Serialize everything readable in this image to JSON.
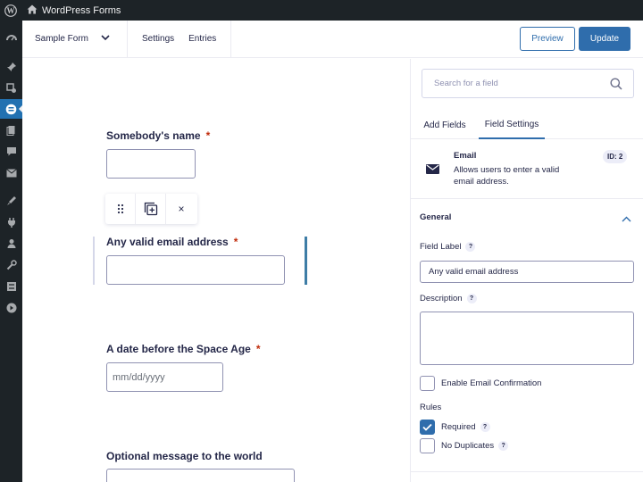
{
  "admin_bar": {
    "site_title": "WordPress Forms"
  },
  "header": {
    "form_name": "Sample Form",
    "nav": [
      "Settings",
      "Entries"
    ],
    "preview_label": "Preview",
    "update_label": "Update"
  },
  "canvas": {
    "fields": [
      {
        "label": "Somebody's name",
        "required_mark": "*"
      },
      {
        "label": "Any valid email address",
        "required_mark": "*"
      },
      {
        "label": "A date before the Space Age",
        "required_mark": "*",
        "placeholder": "mm/dd/yyyy"
      },
      {
        "label": "Optional message to the world"
      }
    ],
    "toolbar": {
      "close_glyph": "×"
    }
  },
  "sidebar": {
    "search_placeholder": "Search for a field",
    "tabs": [
      "Add Fields",
      "Field Settings"
    ],
    "active_tab": "Field Settings",
    "field": {
      "title": "Email",
      "description": "Allows users to enter a valid email address.",
      "id_badge": "ID: 2"
    },
    "general": {
      "heading": "General",
      "field_label_title": "Field Label",
      "field_label_value": "Any valid email address",
      "description_title": "Description",
      "description_value": "",
      "enable_confirmation": "Enable Email Confirmation",
      "rules_title": "Rules",
      "required": "Required",
      "required_checked": true,
      "no_duplicates": "No Duplicates",
      "no_duplicates_checked": false,
      "help_glyph": "?"
    }
  },
  "colors": {
    "accent": "#2f6dac",
    "admin_dark": "#1d2327",
    "required": "#c02b0a"
  }
}
